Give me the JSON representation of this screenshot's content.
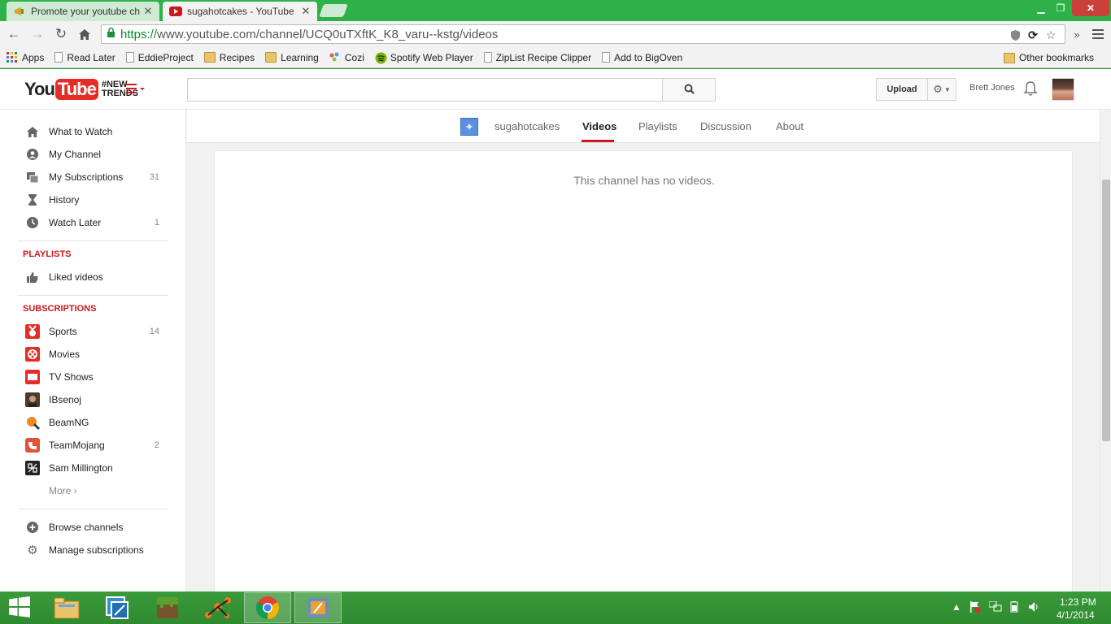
{
  "browser": {
    "tabs": [
      {
        "title": "Promote your youtube ch",
        "active": false
      },
      {
        "title": "sugahotcakes - YouTube",
        "active": true
      }
    ],
    "url_scheme": "https://",
    "url_rest": "www.youtube.com/channel/UCQ0uTXftK_K8_varu--kstg/videos",
    "bookmarks": [
      "Apps",
      "Read Later",
      "EddieProject",
      "Recipes",
      "Learning",
      "Cozi",
      "Spotify Web Player",
      "ZipList Recipe Clipper",
      "Add to BigOven"
    ],
    "other_bookmarks": "Other bookmarks"
  },
  "masthead": {
    "logo_you": "You",
    "logo_tube": "Tube",
    "logo_tag_line1": "#NEW",
    "logo_tag_line2": "TRENDS",
    "upload_label": "Upload",
    "username": "Brett Jones"
  },
  "guide": {
    "main_items": [
      {
        "label": "What to Watch",
        "count": "",
        "icon": "home-icon"
      },
      {
        "label": "My Channel",
        "count": "",
        "icon": "person-icon"
      },
      {
        "label": "My Subscriptions",
        "count": "31",
        "icon": "subscriptions-icon"
      },
      {
        "label": "History",
        "count": "",
        "icon": "hourglass-icon"
      },
      {
        "label": "Watch Later",
        "count": "1",
        "icon": "clock-icon"
      }
    ],
    "playlists_heading": "PLAYLISTS",
    "playlists": [
      {
        "label": "Liked videos",
        "icon": "thumbs-up-icon"
      }
    ],
    "subscriptions_heading": "SUBSCRIPTIONS",
    "subscriptions": [
      {
        "label": "Sports",
        "count": "14",
        "color": "#e52d27"
      },
      {
        "label": "Movies",
        "count": "",
        "color": "#e52d27"
      },
      {
        "label": "TV Shows",
        "count": "",
        "color": "#e52d27"
      },
      {
        "label": "IBsenoj",
        "count": "",
        "color": "#4a3a30"
      },
      {
        "label": "BeamNG",
        "count": "",
        "color": "#f08a24"
      },
      {
        "label": "TeamMojang",
        "count": "2",
        "color": "#e0533a"
      },
      {
        "label": "Sam Millington",
        "count": "",
        "color": "#222222"
      }
    ],
    "more_label": "More ›",
    "bottom_items": [
      {
        "label": "Browse channels",
        "icon": "plus-circle-icon"
      },
      {
        "label": "Manage subscriptions",
        "icon": "gear-icon"
      }
    ]
  },
  "channel": {
    "name": "sugahotcakes",
    "tabs": [
      "Videos",
      "Playlists",
      "Discussion",
      "About"
    ],
    "active_tab": "Videos",
    "empty_message": "This channel has no videos."
  },
  "taskbar": {
    "time": "1:23 PM",
    "date": "4/1/2014",
    "pinned": [
      "file-explorer-icon",
      "remote-desktop-icon",
      "minecraft-icon",
      "network-app-icon",
      "chrome-icon",
      "media-app-icon"
    ]
  }
}
